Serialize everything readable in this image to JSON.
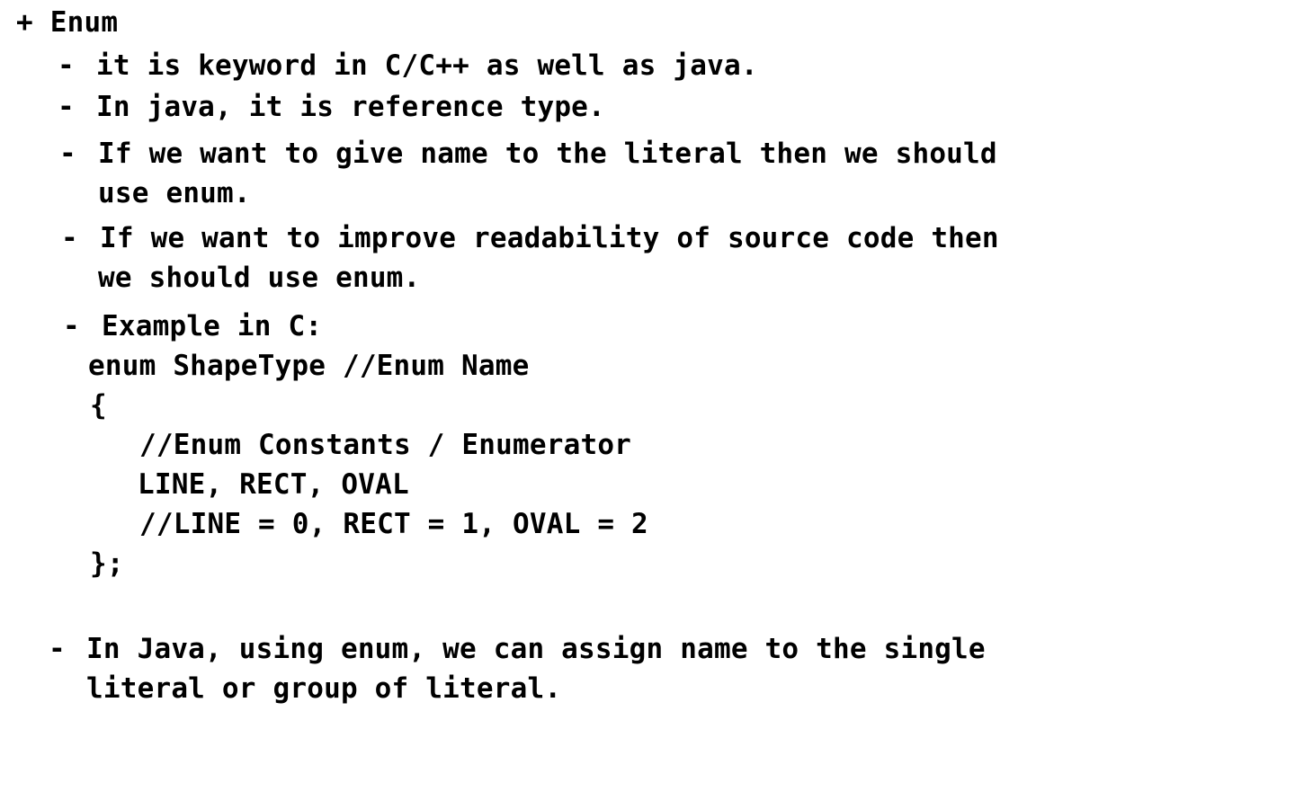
{
  "heading": "+ Enum",
  "bullets": [
    {
      "marker": "-",
      "lines": [
        "it is keyword in C/C++ as well as java."
      ]
    },
    {
      "marker": "-",
      "lines": [
        "In java, it is reference type."
      ]
    },
    {
      "marker": "-",
      "lines": [
        "If we want to give name to the literal then we should",
        "use enum."
      ]
    },
    {
      "marker": "-",
      "lines": [
        "If we want to improve readability of source code then",
        "we should use enum."
      ]
    },
    {
      "marker": "-",
      "lines": [
        "Example in C:"
      ]
    }
  ],
  "code": [
    "enum ShapeType //Enum Name",
    "{",
    "//Enum Constants / Enumerator",
    "LINE, RECT, OVAL",
    "//LINE = 0, RECT = 1, OVAL = 2",
    "};"
  ],
  "last_bullet": {
    "marker": "-",
    "lines": [
      "In Java, using enum, we can assign name to the single",
      "literal or group of literal."
    ]
  }
}
